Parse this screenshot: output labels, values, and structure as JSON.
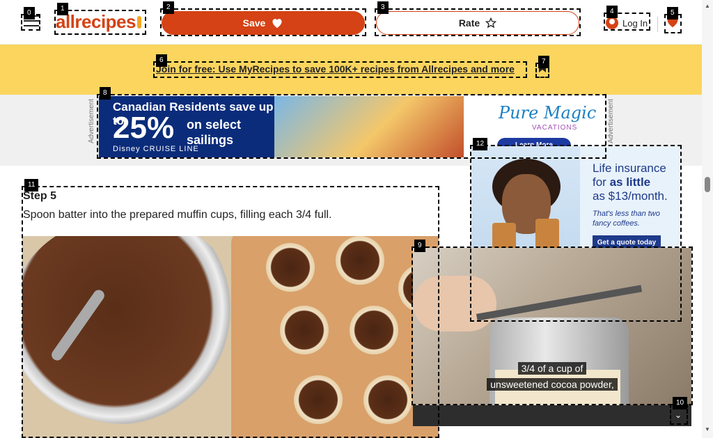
{
  "header": {
    "logo_text": "allrecipes",
    "save_label": "Save",
    "rate_label": "Rate",
    "login_label": "Log In"
  },
  "promo": {
    "link_text": "Join for free: Use MyRecipes to save 100K+ recipes from Allrecipes and more"
  },
  "ads": {
    "advertisement_label": "Advertisement",
    "banner": {
      "line1": "Canadian Residents save up to",
      "percent": "25%",
      "sub": "on select sailings",
      "brand": "Disney CRUISE LINE",
      "partner_logo": "Pure Magic",
      "partner_sub": "VACATIONS",
      "cta": "Learn More"
    },
    "side": {
      "line1": "Life insurance",
      "line2_prefix": "for ",
      "line2_bold": "as little",
      "line3": "as $13/month.",
      "small": "That's less than two fancy coffees.",
      "cta": "Get a quote today"
    }
  },
  "step": {
    "title": "Step 5",
    "text": "Spoon batter into the prepared muffin cups, filling each 3/4 full."
  },
  "video": {
    "caption_line1": "3/4 of a cup of",
    "caption_line2": "unsweetened cocoa powder,"
  },
  "annotations": [
    "0",
    "1",
    "2",
    "3",
    "4",
    "5",
    "6",
    "7",
    "8",
    "9",
    "10",
    "11",
    "12"
  ],
  "colors": {
    "brand": "#d54215",
    "promo_bg": "#fbd55e",
    "ad_band_bg": "#f0f0f0"
  },
  "icons": {
    "menu": "hamburger-icon",
    "save": "heart-icon",
    "rate": "star-icon",
    "login": "user-icon",
    "favorites": "heart-icon",
    "close": "close-icon",
    "adchoices": "adchoices-icon"
  }
}
